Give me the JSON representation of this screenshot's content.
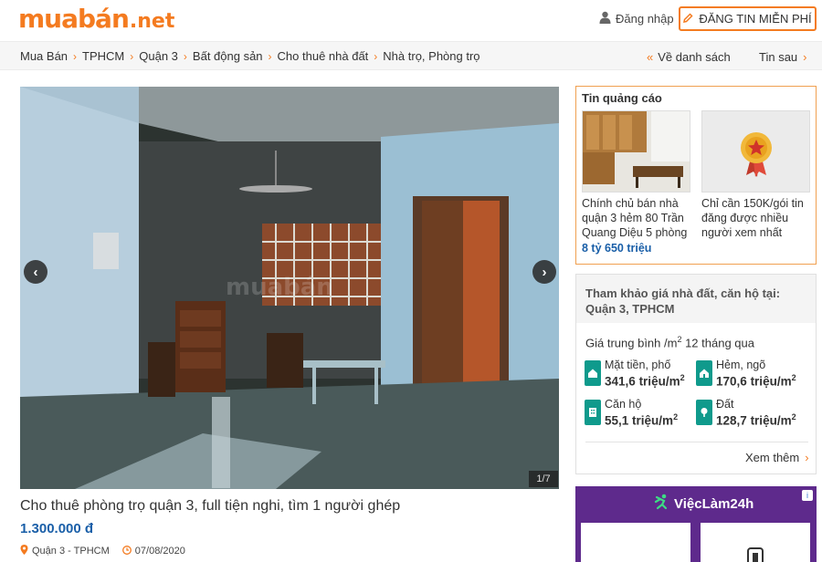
{
  "header": {
    "logo_main": "muabán",
    "logo_tld": ".net",
    "login_label": "Đăng nhập",
    "post_label": "ĐĂNG TIN MIỄN PHÍ",
    "accent": "#f47b20"
  },
  "breadcrumb": {
    "items": [
      "Mua Bán",
      "TPHCM",
      "Quận 3",
      "Bất động sản",
      "Cho thuê nhà đất",
      "Nhà trọ, Phòng trọ"
    ],
    "back_label": "Về danh sách",
    "next_label": "Tin sau"
  },
  "gallery": {
    "counter": "1/7",
    "watermark": "muabán"
  },
  "listing": {
    "title": "Cho thuê phòng trọ quận 3, full tiện nghi, tìm 1 người ghép",
    "price": "1.300.000 đ",
    "location": "Quận 3 - TPHCM",
    "date": "07/08/2020"
  },
  "ads": {
    "title": "Tin quảng cáo",
    "items": [
      {
        "text": "Chính chủ bán nhà quận 3 hẻm 80 Trần Quang Diệu 5 phòng",
        "price": "8 tỷ 650 triệu"
      },
      {
        "text": "Chỉ cần 150K/gói tin đăng được nhiều người xem nhất",
        "price": ""
      }
    ]
  },
  "price_ref": {
    "title": "Tham khảo giá nhà đất, căn hộ tại: Quận 3, TPHCM",
    "subtitle_pre": "Giá trung bình /m",
    "subtitle_post": " 12 tháng qua",
    "unit": "triệu/m",
    "items": [
      {
        "label": "Mặt tiền, phố",
        "value": "341,6"
      },
      {
        "label": "Hẻm, ngõ",
        "value": "170,6"
      },
      {
        "label": "Căn hộ",
        "value": "55,1"
      },
      {
        "label": "Đất",
        "value": "128,7"
      }
    ],
    "see_more": "Xem thêm"
  },
  "vieclam": {
    "brand": "ViệcLàm24h"
  }
}
